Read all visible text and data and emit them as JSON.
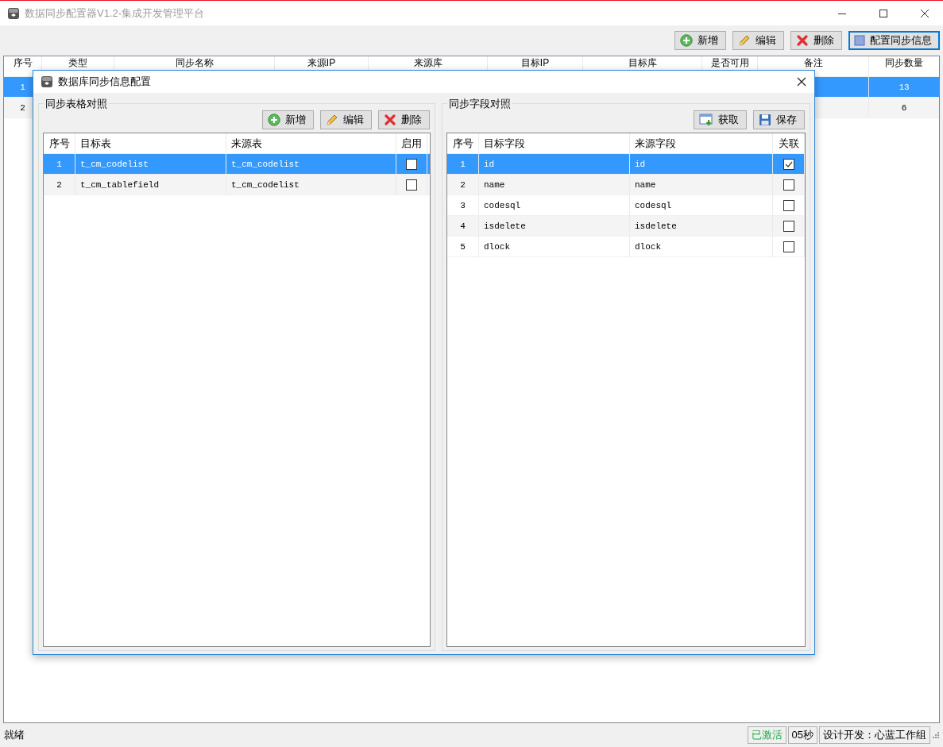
{
  "window": {
    "title": "数据同步配置器V1.2-集成开发管理平台"
  },
  "toolbar": [
    {
      "label": "新增",
      "kind": "add",
      "focused": false
    },
    {
      "label": "编辑",
      "kind": "edit",
      "focused": false
    },
    {
      "label": "删除",
      "kind": "delete",
      "focused": false
    },
    {
      "label": "配置同步信息",
      "kind": "config",
      "focused": true
    }
  ],
  "main_table": {
    "columns": [
      "序号",
      "类型",
      "同步名称",
      "来源IP",
      "来源库",
      "目标IP",
      "目标库",
      "是否可用",
      "备注",
      "同步数量"
    ],
    "rows": [
      {
        "seq": "1",
        "sync_count": "13",
        "selected": true
      },
      {
        "seq": "2",
        "sync_count": "6",
        "selected": false
      }
    ]
  },
  "dialog": {
    "title": "数据库同步信息配置",
    "table_group": {
      "title": "同步表格对照",
      "buttons": [
        {
          "label": "新增",
          "kind": "add"
        },
        {
          "label": "编辑",
          "kind": "edit"
        },
        {
          "label": "删除",
          "kind": "delete"
        }
      ],
      "columns": [
        "序号",
        "目标表",
        "来源表",
        "启用"
      ],
      "rows": [
        {
          "cells": [
            "1",
            "t_cm_codelist",
            "t_cm_codelist"
          ],
          "checked": false,
          "selected": true
        },
        {
          "cells": [
            "2",
            "t_cm_tablefield",
            "t_cm_codelist"
          ],
          "checked": false,
          "selected": false
        }
      ]
    },
    "field_group": {
      "title": "同步字段对照",
      "buttons": [
        {
          "label": "获取",
          "kind": "fetch"
        },
        {
          "label": "保存",
          "kind": "save"
        }
      ],
      "columns": [
        "序号",
        "目标字段",
        "来源字段",
        "关联"
      ],
      "rows": [
        {
          "cells": [
            "1",
            "id",
            "id"
          ],
          "checked": true,
          "selected": true
        },
        {
          "cells": [
            "2",
            "name",
            "name"
          ],
          "checked": false,
          "selected": false
        },
        {
          "cells": [
            "3",
            "codesql",
            "codesql"
          ],
          "checked": false,
          "selected": false
        },
        {
          "cells": [
            "4",
            "isdelete",
            "isdelete"
          ],
          "checked": false,
          "selected": false
        },
        {
          "cells": [
            "5",
            "dlock",
            "dlock"
          ],
          "checked": false,
          "selected": false
        }
      ]
    }
  },
  "status_bar": {
    "message": "就绪",
    "panels": [
      {
        "text": "已激活",
        "kind": "activated"
      },
      {
        "text": "05秒",
        "kind": "plain"
      },
      {
        "text": "设计开发：心蓝工作组",
        "kind": "plain"
      }
    ]
  }
}
